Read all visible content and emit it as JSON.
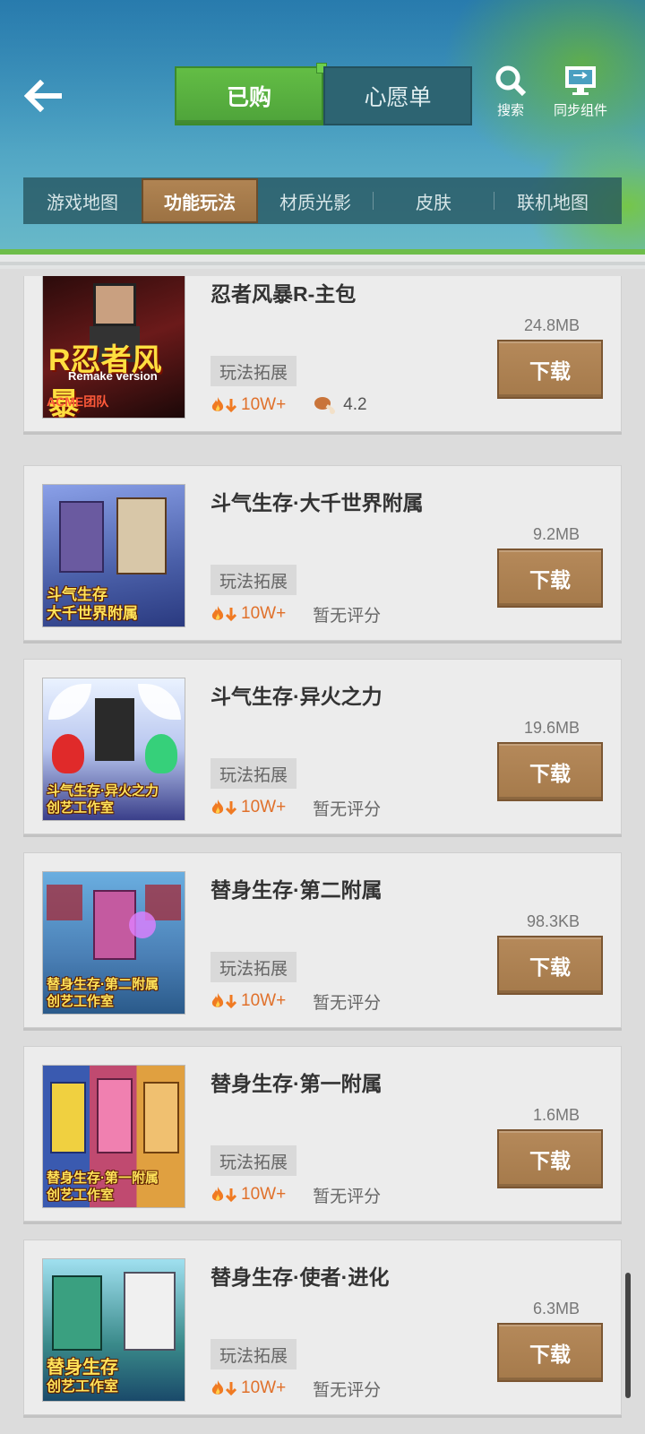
{
  "header": {
    "tabs": [
      {
        "label": "已购",
        "active": true
      },
      {
        "label": "心愿单",
        "active": false
      }
    ],
    "search_label": "搜索",
    "sync_label": "同步组件"
  },
  "subtabs": [
    {
      "label": "游戏地图",
      "active": false
    },
    {
      "label": "功能玩法",
      "active": true
    },
    {
      "label": "材质光影",
      "active": false
    },
    {
      "label": "皮肤",
      "active": false
    },
    {
      "label": "联机地图",
      "active": false
    }
  ],
  "items": [
    {
      "title": "忍者风暴R-主包",
      "size": "24.8MB",
      "tag": "玩法拓展",
      "downloads": "10W+",
      "rating": "4.2",
      "rating_icon": "drumstick-icon",
      "button": "下载",
      "thumb_caption_1": "R忍者风暴",
      "thumb_caption_2": "Remake version",
      "thumb_caption_3": "ACME团队",
      "theme": "#5a1212"
    },
    {
      "title": "斗气生存·大千世界附属",
      "size": "9.2MB",
      "tag": "玩法拓展",
      "downloads": "10W+",
      "rating": "暂无评分",
      "button": "下载",
      "thumb_caption_1": "斗气生存",
      "thumb_caption_2": "大千世界附属",
      "theme": "#4a5fa8"
    },
    {
      "title": "斗气生存·异火之力",
      "size": "19.6MB",
      "tag": "玩法拓展",
      "downloads": "10W+",
      "rating": "暂无评分",
      "button": "下载",
      "thumb_caption_1": "斗气生存·异火之力",
      "thumb_caption_2": "创艺工作室",
      "theme": "#3a3f8a"
    },
    {
      "title": "替身生存·第二附属",
      "size": "98.3KB",
      "tag": "玩法拓展",
      "downloads": "10W+",
      "rating": "暂无评分",
      "button": "下载",
      "thumb_caption_1": "替身生存·第二附属",
      "thumb_caption_2": "创艺工作室",
      "theme": "#4a7fb5"
    },
    {
      "title": "替身生存·第一附属",
      "size": "1.6MB",
      "tag": "玩法拓展",
      "downloads": "10W+",
      "rating": "暂无评分",
      "button": "下载",
      "thumb_caption_1": "替身生存·第一附属",
      "thumb_caption_2": "创艺工作室",
      "theme": "#8a3a5a"
    },
    {
      "title": "替身生存·使者·进化",
      "size": "6.3MB",
      "tag": "玩法拓展",
      "downloads": "10W+",
      "rating": "暂无评分",
      "button": "下载",
      "thumb_caption_1": "替身生存",
      "thumb_caption_2": "创艺工作室",
      "theme": "#3a8a8a"
    }
  ]
}
